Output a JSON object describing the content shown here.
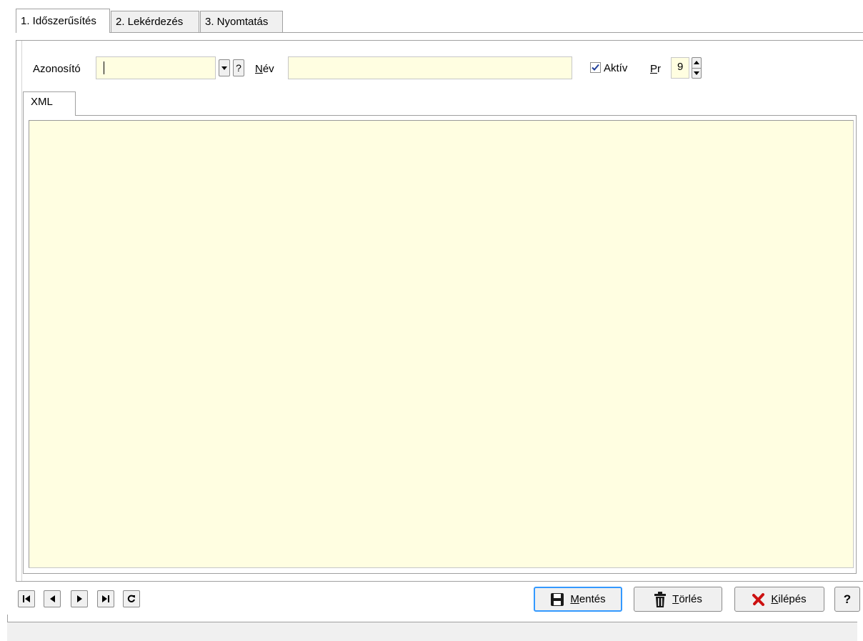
{
  "tabs": [
    {
      "label": "1. Időszerűsítés",
      "active": true
    },
    {
      "label": "2. Lekérdezés",
      "active": false
    },
    {
      "label": "3. Nyomtatás",
      "active": false
    }
  ],
  "form": {
    "azonosito_label": "Azonosító",
    "azonosito_value": "",
    "help_glyph": "?",
    "nev_label_first": "N",
    "nev_label_rest": "év",
    "nev_value": "",
    "aktiv_label": "Aktív",
    "aktiv_checked": true,
    "pr_label_first": "P",
    "pr_label_rest": "r",
    "pr_value": "9"
  },
  "inner_tabs": [
    {
      "label": "XML",
      "active": true
    }
  ],
  "xml_content": "",
  "nav_icons": [
    "first-record-icon",
    "previous-record-icon",
    "next-record-icon",
    "last-record-icon",
    "refresh-icon"
  ],
  "buttons": {
    "save_first": "M",
    "save_rest": "entés",
    "delete_first": "T",
    "delete_rest": "örlés",
    "exit_first": "K",
    "exit_rest": "ilépés",
    "help_label": "?"
  },
  "colors": {
    "field_background": "#fffee1",
    "window_background": "#f0f0f0",
    "focus_border": "#3399ff",
    "exit_icon": "#cc1111"
  }
}
